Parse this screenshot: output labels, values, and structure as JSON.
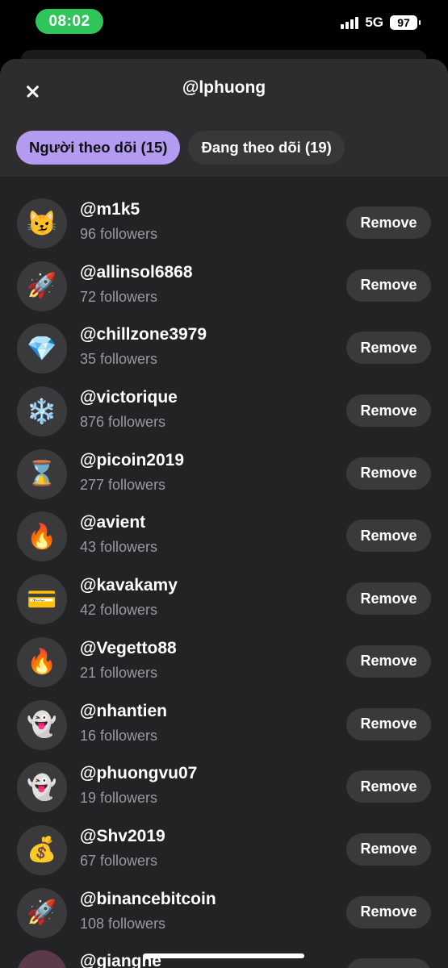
{
  "status_bar": {
    "time": "08:02",
    "network": "5G",
    "battery": "97"
  },
  "header": {
    "title": "@lphuong"
  },
  "tabs": [
    {
      "label": "Người theo dõi (15)",
      "active": true
    },
    {
      "label": "Đang theo dõi (19)",
      "active": false
    }
  ],
  "followers": [
    {
      "username": "@m1k5",
      "followers": "96 followers",
      "avatar": "😼",
      "action": "Remove"
    },
    {
      "username": "@allinsol6868",
      "followers": "72 followers",
      "avatar": "🚀",
      "action": "Remove"
    },
    {
      "username": "@chillzone3979",
      "followers": "35 followers",
      "avatar": "💎",
      "action": "Remove"
    },
    {
      "username": "@victorique",
      "followers": "876 followers",
      "avatar": "❄️",
      "action": "Remove"
    },
    {
      "username": "@picoin2019",
      "followers": "277 followers",
      "avatar": "⌛",
      "action": "Remove"
    },
    {
      "username": "@avient",
      "followers": "43 followers",
      "avatar": "🔥",
      "action": "Remove"
    },
    {
      "username": "@kavakamy",
      "followers": "42 followers",
      "avatar": "💳",
      "action": "Remove"
    },
    {
      "username": "@Vegetto88",
      "followers": "21 followers",
      "avatar": "🔥",
      "action": "Remove"
    },
    {
      "username": "@nhantien",
      "followers": "16 followers",
      "avatar": "👻",
      "action": "Remove"
    },
    {
      "username": "@phuongvu07",
      "followers": "19 followers",
      "avatar": "👻",
      "action": "Remove"
    },
    {
      "username": "@Shv2019",
      "followers": "67 followers",
      "avatar": "💰",
      "action": "Remove"
    },
    {
      "username": "@binancebitcoin",
      "followers": "108 followers",
      "avatar": "🚀",
      "action": "Remove"
    },
    {
      "username": "@giangne",
      "followers": "",
      "avatar": "",
      "action": "Remove"
    }
  ]
}
